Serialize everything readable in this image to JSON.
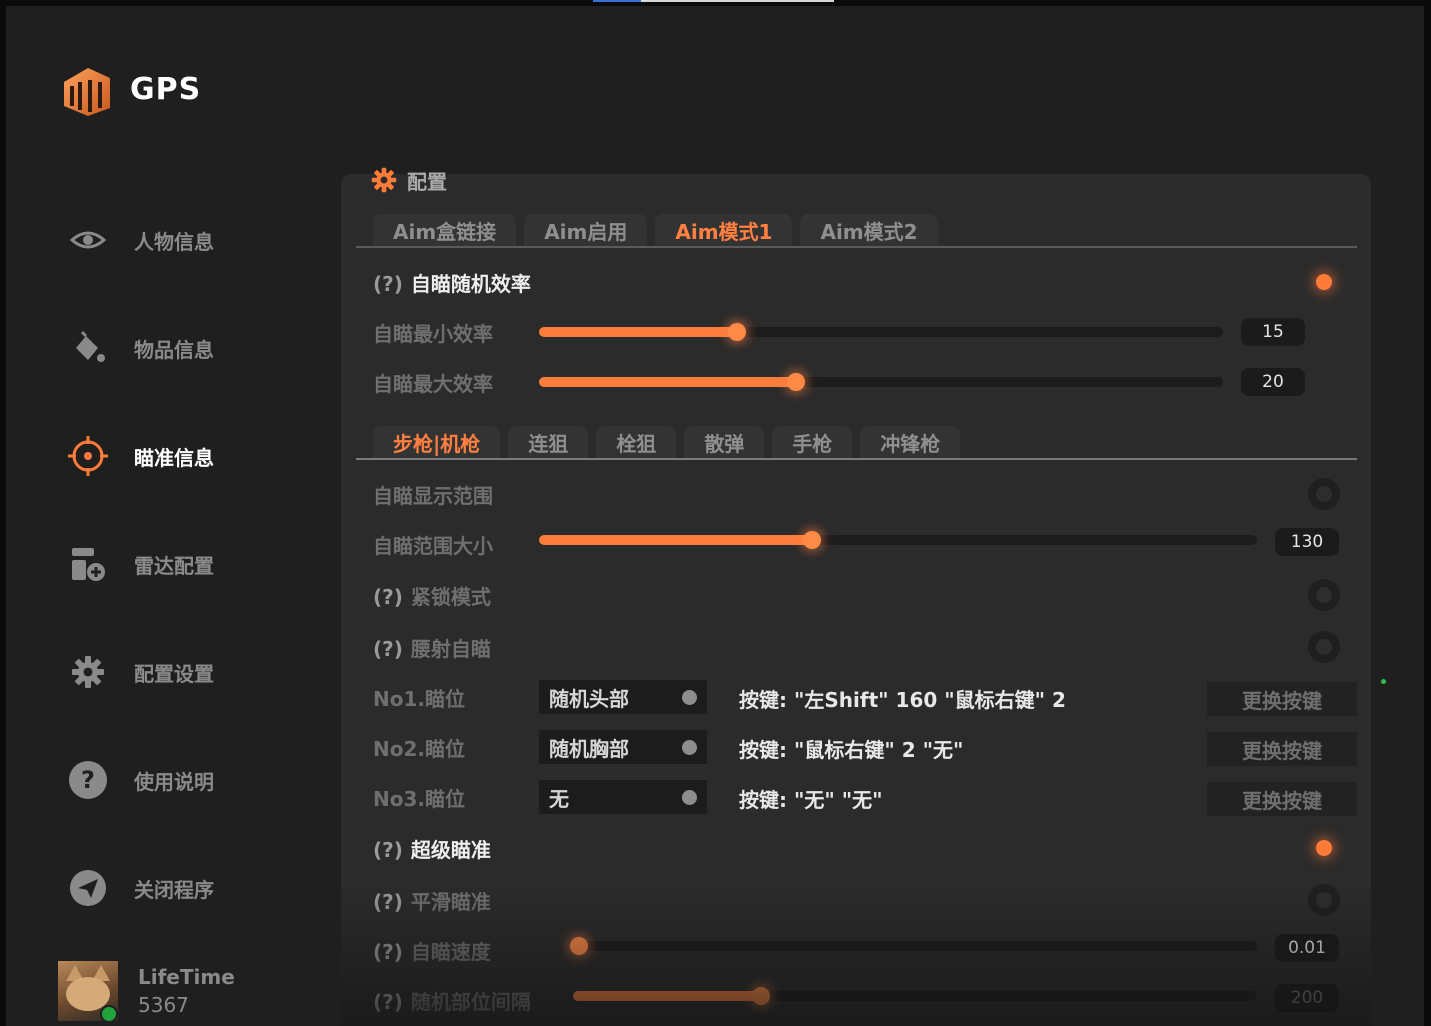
{
  "app": {
    "title": "GPS"
  },
  "sidebar": {
    "items": [
      {
        "label": "人物信息",
        "icon": "eye-icon",
        "active": false
      },
      {
        "label": "物品信息",
        "icon": "paint-bucket-icon",
        "active": false
      },
      {
        "label": "瞄准信息",
        "icon": "crosshair-icon",
        "active": true
      },
      {
        "label": "雷达配置",
        "icon": "radar-config-icon",
        "active": false
      },
      {
        "label": "配置设置",
        "icon": "gear-icon",
        "active": false
      },
      {
        "label": "使用说明",
        "icon": "help-icon",
        "active": false
      },
      {
        "label": "关闭程序",
        "icon": "paper-plane-icon",
        "active": false
      }
    ]
  },
  "user": {
    "name": "LifeTime",
    "count": "5367",
    "status": "online"
  },
  "panel": {
    "title": "配置",
    "tabs": [
      "Aim盒链接",
      "Aim启用",
      "Aim模式1",
      "Aim模式2"
    ],
    "active_tab": "Aim模式1",
    "random_efficiency": {
      "q": "(?)",
      "label": "自瞄随机效率",
      "enabled": true
    },
    "min_efficiency": {
      "label": "自瞄最小效率",
      "value": "15",
      "fraction": 0.29
    },
    "max_efficiency": {
      "label": "自瞄最大效率",
      "value": "20",
      "fraction": 0.375
    },
    "weapon_tabs": [
      "步枪|机枪",
      "连狙",
      "栓狙",
      "散弹",
      "手枪",
      "冲锋枪"
    ],
    "active_weapon_tab": "步枪|机枪",
    "show_range": {
      "label": "自瞄显示范围",
      "enabled": false
    },
    "range_size": {
      "label": "自瞄范围大小",
      "value": "130",
      "fraction": 0.38
    },
    "tight_lock": {
      "q": "(?)",
      "label": "紧锁模式",
      "enabled": false
    },
    "hip_fire": {
      "q": "(?)",
      "label": "腰射自瞄",
      "enabled": false
    },
    "aim_slots": [
      {
        "label": "No1.瞄位",
        "value": "随机头部",
        "keys": "按键: \"左Shift\" 160  \"鼠标右键\" 2",
        "button": "更换按键"
      },
      {
        "label": "No2.瞄位",
        "value": "随机胸部",
        "keys": "按键: \"鼠标右键\" 2  \"无\"",
        "button": "更换按键"
      },
      {
        "label": "No3.瞄位",
        "value": "无",
        "keys": "按键: \"无\"  \"无\"",
        "button": "更换按键"
      }
    ],
    "super_aim": {
      "q": "(?)",
      "label": "超级瞄准",
      "enabled": true
    },
    "smooth_aim": {
      "q": "(?)",
      "label": "平滑瞄准",
      "enabled": false
    },
    "aim_speed": {
      "q": "(?)",
      "label": "自瞄速度",
      "value": "0.01",
      "fraction": 0.0
    },
    "random_interval": {
      "q": "(?)",
      "label": "随机部位间隔",
      "value": "200",
      "fraction": 0.275
    }
  },
  "colors": {
    "accent": "#ff7e3d",
    "background": "#1f1f1f",
    "panel": "#2b2b2b"
  }
}
